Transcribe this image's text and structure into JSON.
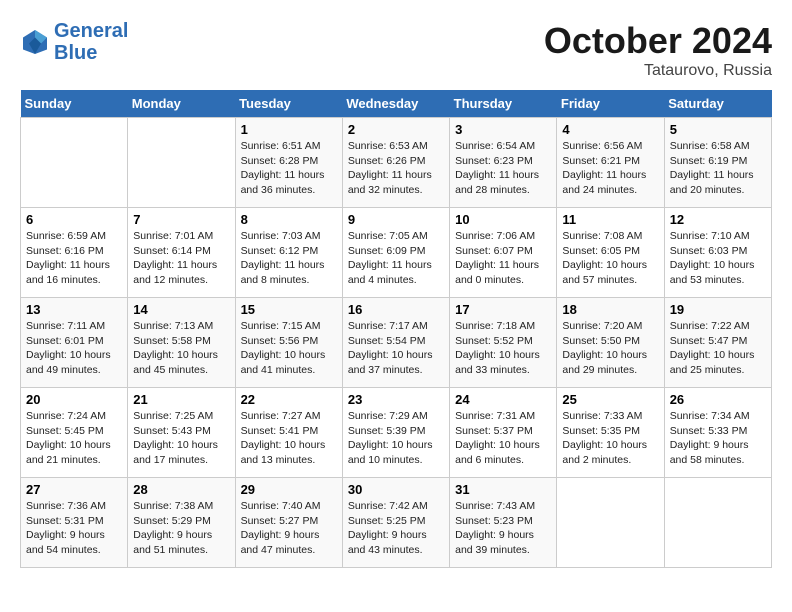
{
  "logo": {
    "line1": "General",
    "line2": "Blue"
  },
  "title": "October 2024",
  "location": "Tataurovo, Russia",
  "days_header": [
    "Sunday",
    "Monday",
    "Tuesday",
    "Wednesday",
    "Thursday",
    "Friday",
    "Saturday"
  ],
  "weeks": [
    [
      {
        "day": "",
        "info": ""
      },
      {
        "day": "",
        "info": ""
      },
      {
        "day": "1",
        "info": "Sunrise: 6:51 AM\nSunset: 6:28 PM\nDaylight: 11 hours\nand 36 minutes."
      },
      {
        "day": "2",
        "info": "Sunrise: 6:53 AM\nSunset: 6:26 PM\nDaylight: 11 hours\nand 32 minutes."
      },
      {
        "day": "3",
        "info": "Sunrise: 6:54 AM\nSunset: 6:23 PM\nDaylight: 11 hours\nand 28 minutes."
      },
      {
        "day": "4",
        "info": "Sunrise: 6:56 AM\nSunset: 6:21 PM\nDaylight: 11 hours\nand 24 minutes."
      },
      {
        "day": "5",
        "info": "Sunrise: 6:58 AM\nSunset: 6:19 PM\nDaylight: 11 hours\nand 20 minutes."
      }
    ],
    [
      {
        "day": "6",
        "info": "Sunrise: 6:59 AM\nSunset: 6:16 PM\nDaylight: 11 hours\nand 16 minutes."
      },
      {
        "day": "7",
        "info": "Sunrise: 7:01 AM\nSunset: 6:14 PM\nDaylight: 11 hours\nand 12 minutes."
      },
      {
        "day": "8",
        "info": "Sunrise: 7:03 AM\nSunset: 6:12 PM\nDaylight: 11 hours\nand 8 minutes."
      },
      {
        "day": "9",
        "info": "Sunrise: 7:05 AM\nSunset: 6:09 PM\nDaylight: 11 hours\nand 4 minutes."
      },
      {
        "day": "10",
        "info": "Sunrise: 7:06 AM\nSunset: 6:07 PM\nDaylight: 11 hours\nand 0 minutes."
      },
      {
        "day": "11",
        "info": "Sunrise: 7:08 AM\nSunset: 6:05 PM\nDaylight: 10 hours\nand 57 minutes."
      },
      {
        "day": "12",
        "info": "Sunrise: 7:10 AM\nSunset: 6:03 PM\nDaylight: 10 hours\nand 53 minutes."
      }
    ],
    [
      {
        "day": "13",
        "info": "Sunrise: 7:11 AM\nSunset: 6:01 PM\nDaylight: 10 hours\nand 49 minutes."
      },
      {
        "day": "14",
        "info": "Sunrise: 7:13 AM\nSunset: 5:58 PM\nDaylight: 10 hours\nand 45 minutes."
      },
      {
        "day": "15",
        "info": "Sunrise: 7:15 AM\nSunset: 5:56 PM\nDaylight: 10 hours\nand 41 minutes."
      },
      {
        "day": "16",
        "info": "Sunrise: 7:17 AM\nSunset: 5:54 PM\nDaylight: 10 hours\nand 37 minutes."
      },
      {
        "day": "17",
        "info": "Sunrise: 7:18 AM\nSunset: 5:52 PM\nDaylight: 10 hours\nand 33 minutes."
      },
      {
        "day": "18",
        "info": "Sunrise: 7:20 AM\nSunset: 5:50 PM\nDaylight: 10 hours\nand 29 minutes."
      },
      {
        "day": "19",
        "info": "Sunrise: 7:22 AM\nSunset: 5:47 PM\nDaylight: 10 hours\nand 25 minutes."
      }
    ],
    [
      {
        "day": "20",
        "info": "Sunrise: 7:24 AM\nSunset: 5:45 PM\nDaylight: 10 hours\nand 21 minutes."
      },
      {
        "day": "21",
        "info": "Sunrise: 7:25 AM\nSunset: 5:43 PM\nDaylight: 10 hours\nand 17 minutes."
      },
      {
        "day": "22",
        "info": "Sunrise: 7:27 AM\nSunset: 5:41 PM\nDaylight: 10 hours\nand 13 minutes."
      },
      {
        "day": "23",
        "info": "Sunrise: 7:29 AM\nSunset: 5:39 PM\nDaylight: 10 hours\nand 10 minutes."
      },
      {
        "day": "24",
        "info": "Sunrise: 7:31 AM\nSunset: 5:37 PM\nDaylight: 10 hours\nand 6 minutes."
      },
      {
        "day": "25",
        "info": "Sunrise: 7:33 AM\nSunset: 5:35 PM\nDaylight: 10 hours\nand 2 minutes."
      },
      {
        "day": "26",
        "info": "Sunrise: 7:34 AM\nSunset: 5:33 PM\nDaylight: 9 hours\nand 58 minutes."
      }
    ],
    [
      {
        "day": "27",
        "info": "Sunrise: 7:36 AM\nSunset: 5:31 PM\nDaylight: 9 hours\nand 54 minutes."
      },
      {
        "day": "28",
        "info": "Sunrise: 7:38 AM\nSunset: 5:29 PM\nDaylight: 9 hours\nand 51 minutes."
      },
      {
        "day": "29",
        "info": "Sunrise: 7:40 AM\nSunset: 5:27 PM\nDaylight: 9 hours\nand 47 minutes."
      },
      {
        "day": "30",
        "info": "Sunrise: 7:42 AM\nSunset: 5:25 PM\nDaylight: 9 hours\nand 43 minutes."
      },
      {
        "day": "31",
        "info": "Sunrise: 7:43 AM\nSunset: 5:23 PM\nDaylight: 9 hours\nand 39 minutes."
      },
      {
        "day": "",
        "info": ""
      },
      {
        "day": "",
        "info": ""
      }
    ]
  ]
}
